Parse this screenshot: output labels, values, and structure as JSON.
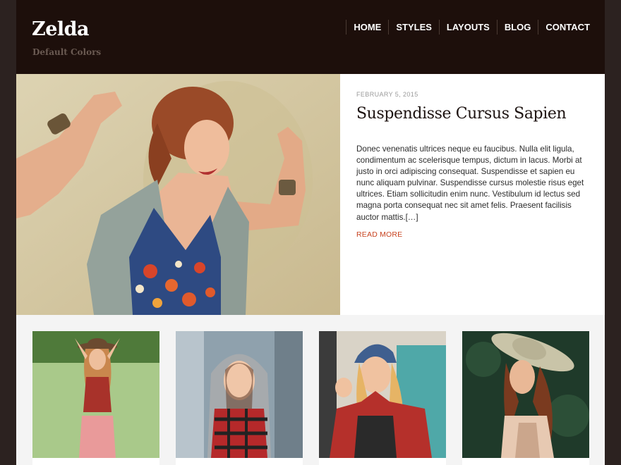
{
  "site": {
    "title": "Zelda",
    "tagline": "Default Colors"
  },
  "nav": {
    "items": [
      {
        "label": "HOME"
      },
      {
        "label": "STYLES"
      },
      {
        "label": "LAYOUTS"
      },
      {
        "label": "BLOG"
      },
      {
        "label": "CONTACT"
      }
    ]
  },
  "featured": {
    "date": "FEBRUARY 5, 2015",
    "title": "Suspendisse Cursus Sapien",
    "excerpt": "Donec venenatis ultrices neque eu faucibus. Nulla elit ligula, condimentum ac scelerisque tempus, dictum in lacus. Morbi at justo in orci adipiscing consequat. Suspendisse et sapien eu nunc aliquam pulvinar. Suspendisse cursus molestie risus eget ultrices. Etiam sollicitudin enim nunc. Vestibulum id lectus sed magna porta consequat nec sit amet felis. Praesent facilisis auctor mattis.[…]",
    "read_more": "READ MORE"
  },
  "colors": {
    "header_bg": "#1d0f0b",
    "accent": "#c7421f",
    "page_bg": "#2c2220"
  }
}
